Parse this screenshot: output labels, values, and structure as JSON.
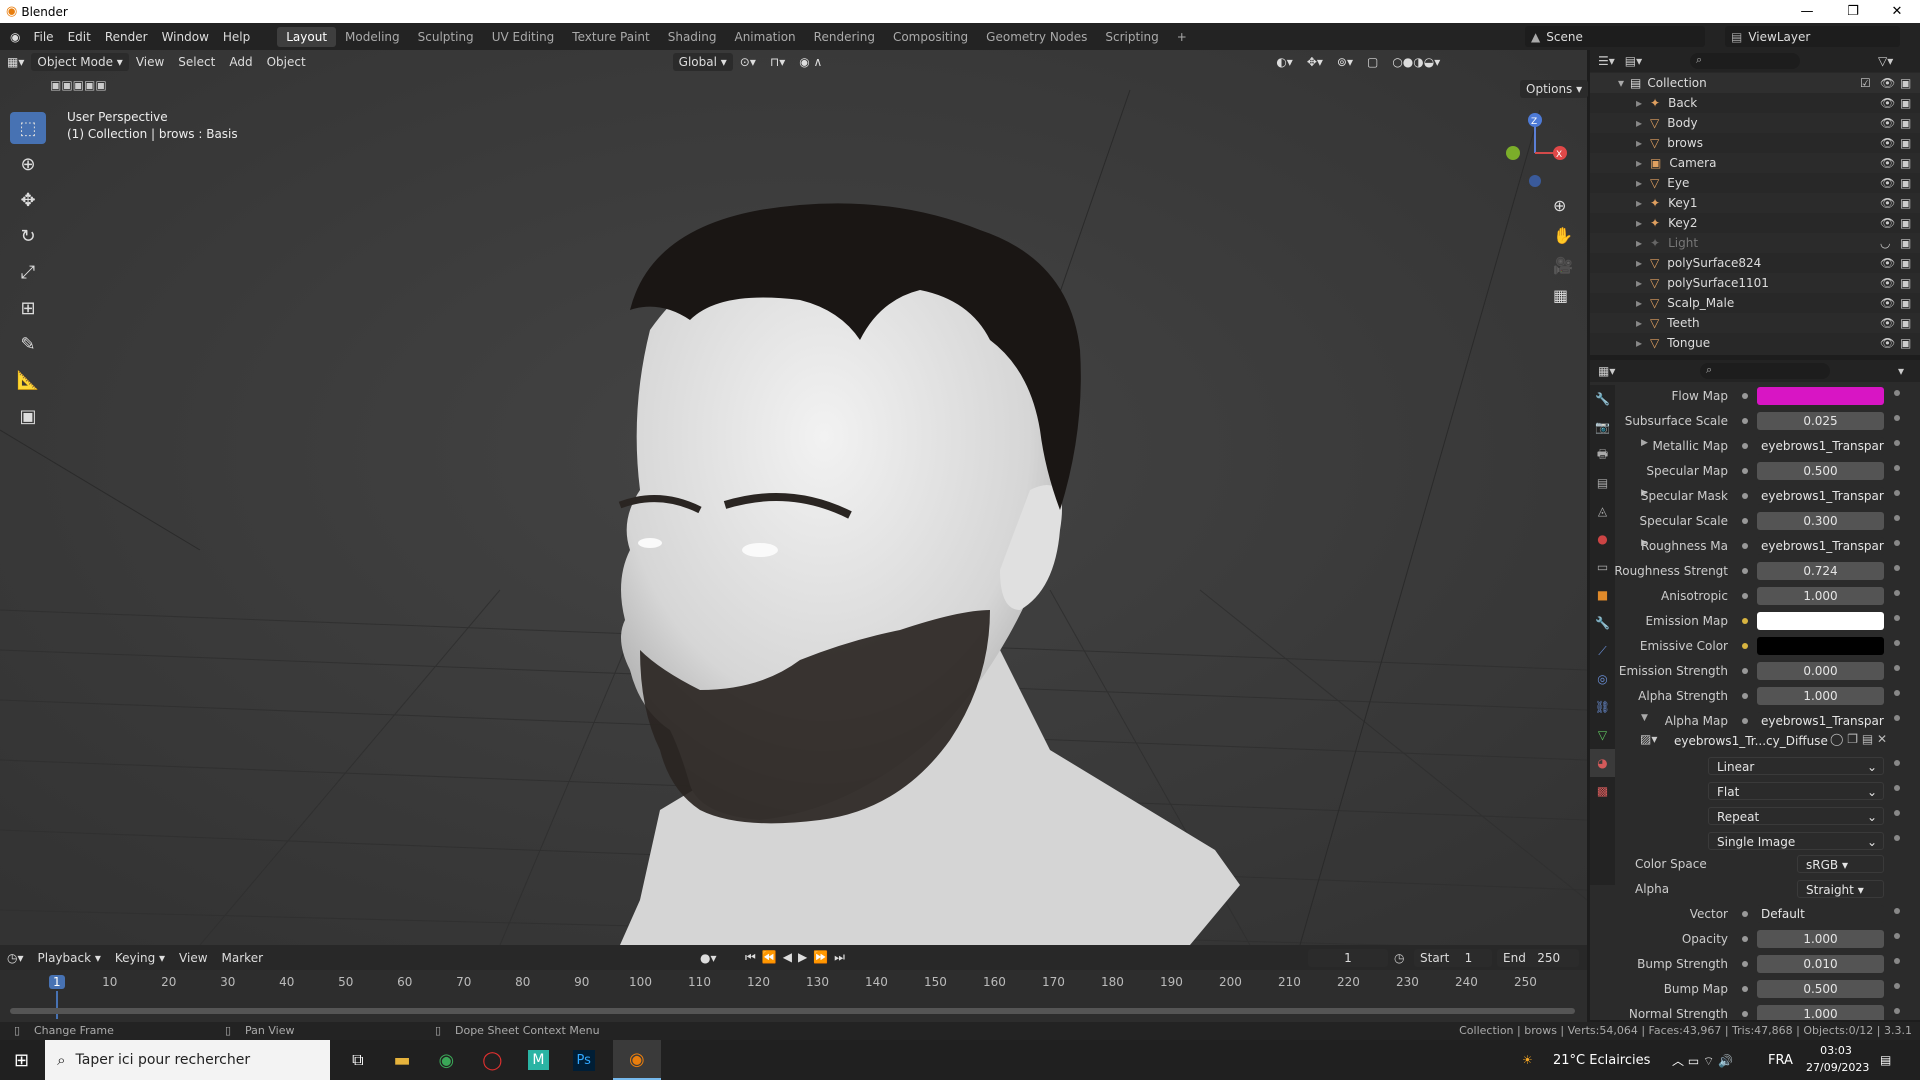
{
  "window": {
    "title": "Blender"
  },
  "menus": [
    "File",
    "Edit",
    "Render",
    "Window",
    "Help"
  ],
  "workspaces": [
    "Layout",
    "Modeling",
    "Sculpting",
    "UV Editing",
    "Texture Paint",
    "Shading",
    "Animation",
    "Rendering",
    "Compositing",
    "Geometry Nodes",
    "Scripting"
  ],
  "active_workspace": "Layout",
  "scene": {
    "label": "Scene",
    "viewlayer": "ViewLayer"
  },
  "viewport": {
    "mode": "Object Mode",
    "menu": [
      "View",
      "Select",
      "Add",
      "Object"
    ],
    "orientation": "Global",
    "options": "Options",
    "info_line1": "User Perspective",
    "info_line2": "(1) Collection | brows : Basis"
  },
  "outliner": {
    "root": "Collection",
    "items": [
      "Back",
      "Body",
      "brows",
      "Camera",
      "Eye",
      "Key1",
      "Key2",
      "Light",
      "polySurface824",
      "polySurface1101",
      "Scalp_Male",
      "Teeth",
      "Tongue"
    ]
  },
  "properties": {
    "rows": [
      {
        "label": "Flow Map",
        "value": "",
        "kind": "color",
        "color": "#d815c4"
      },
      {
        "label": "Subsurface Scale",
        "value": "0.025",
        "kind": "num"
      },
      {
        "label": "Metallic Map",
        "value": "eyebrows1_Transparen...",
        "kind": "txt",
        "expand": true
      },
      {
        "label": "Specular Map",
        "value": "0.500",
        "kind": "num"
      },
      {
        "label": "Specular Mask",
        "value": "eyebrows1_Transparen...",
        "kind": "txt",
        "expand": true
      },
      {
        "label": "Specular Scale",
        "value": "0.300",
        "kind": "num"
      },
      {
        "label": "Roughness Ma",
        "value": "eyebrows1_Transparen...",
        "kind": "txt",
        "expand": true
      },
      {
        "label": "Roughness Strengt",
        "value": "0.724",
        "kind": "num"
      },
      {
        "label": "Anisotropic",
        "value": "1.000",
        "kind": "num"
      },
      {
        "label": "Emission Map",
        "value": "",
        "kind": "color",
        "color": "#ffffff",
        "yellow": true
      },
      {
        "label": "Emissive Color",
        "value": "",
        "kind": "color",
        "color": "#000000",
        "yellow": true
      },
      {
        "label": "Emission Strength",
        "value": "0.000",
        "kind": "num"
      },
      {
        "label": "Alpha Strength",
        "value": "1.000",
        "kind": "num"
      },
      {
        "label": "Alpha Map",
        "value": "eyebrows1_Transparen...",
        "kind": "txt",
        "expand": true,
        "open": true
      }
    ],
    "image_name": "eyebrows1_Tr...cy_Diffuse.png",
    "dropdowns": [
      "Linear",
      "Flat",
      "Repeat",
      "Single Image"
    ],
    "color_space_label": "Color Space",
    "color_space": "sRGB",
    "alpha_label": "Alpha",
    "alpha": "Straight",
    "rows2": [
      {
        "label": "Vector",
        "value": "Default",
        "kind": "txt"
      },
      {
        "label": "Opacity",
        "value": "1.000",
        "kind": "num"
      },
      {
        "label": "Bump Strength",
        "value": "0.010",
        "kind": "num"
      },
      {
        "label": "Bump Map",
        "value": "0.500",
        "kind": "num"
      },
      {
        "label": "Normal Strength",
        "value": "1.000",
        "kind": "num"
      }
    ]
  },
  "timeline": {
    "menus": [
      "Playback",
      "Keying",
      "View",
      "Marker"
    ],
    "current_frame": "1",
    "start_label": "Start",
    "start": "1",
    "end_label": "End",
    "end": "250",
    "ticks": [
      "1",
      "10",
      "20",
      "30",
      "40",
      "50",
      "60",
      "70",
      "80",
      "90",
      "100",
      "110",
      "120",
      "130",
      "140",
      "150",
      "160",
      "170",
      "180",
      "190",
      "200",
      "210",
      "220",
      "230",
      "240",
      "250"
    ]
  },
  "status": {
    "left1": "Change Frame",
    "left2": "Pan View",
    "left3": "Dope Sheet Context Menu",
    "right": "Collection | brows | Verts:54,064 | Faces:43,967 | Tris:47,868 | Objects:0/12 | 3.3.1"
  },
  "taskbar": {
    "search_placeholder": "Taper ici pour rechercher",
    "weather": "21°C  Eclaircies",
    "lang": "FRA",
    "time": "03:03",
    "date": "27/09/2023"
  }
}
